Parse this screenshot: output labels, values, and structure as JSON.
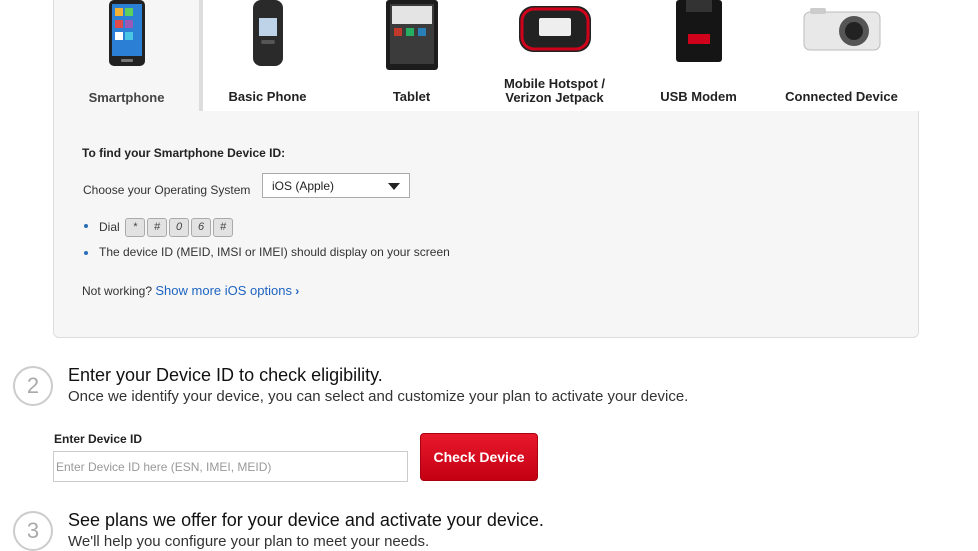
{
  "device_tabs": [
    {
      "label": "Smartphone",
      "active": true,
      "icon": "smartphone-icon"
    },
    {
      "label": "Basic Phone",
      "active": false,
      "icon": "flip-phone-icon"
    },
    {
      "label": "Tablet",
      "active": false,
      "icon": "tablet-icon"
    },
    {
      "label": "Mobile Hotspot / Verizon Jetpack",
      "line1": "Mobile Hotspot /",
      "line2": "Verizon Jetpack",
      "active": false,
      "icon": "hotspot-icon"
    },
    {
      "label": "USB Modem",
      "active": false,
      "icon": "usb-modem-icon"
    },
    {
      "label": "Connected Device",
      "active": false,
      "icon": "camera-icon"
    }
  ],
  "panel": {
    "heading": "To find your Smartphone Device ID:",
    "os_label": "Choose your Operating System",
    "os_selected": "iOS (Apple)",
    "dial_label": "Dial",
    "dial_keys": [
      "*",
      "#",
      "0",
      "6",
      "#"
    ],
    "instruction": "The device ID (MEID, IMSI or IMEI) should display on your screen",
    "not_working": "Not working?",
    "more_options_link": "Show more iOS options"
  },
  "step2": {
    "number": "2",
    "title": "Enter your Device ID to check eligibility.",
    "subtitle": "Once we identify your device, you can select and customize your plan to activate your device.",
    "field_label": "Enter Device ID",
    "field_placeholder": "Enter Device ID here (ESN, IMEI, MEID)",
    "button_label": "Check Device"
  },
  "step3": {
    "number": "3",
    "title": "See plans we offer for your device and activate your device.",
    "subtitle": "We'll help you configure your plan to meet your needs."
  },
  "colors": {
    "accent_red": "#d0021b",
    "link_blue": "#1d64c1",
    "panel_bg": "#f6f6f6"
  }
}
